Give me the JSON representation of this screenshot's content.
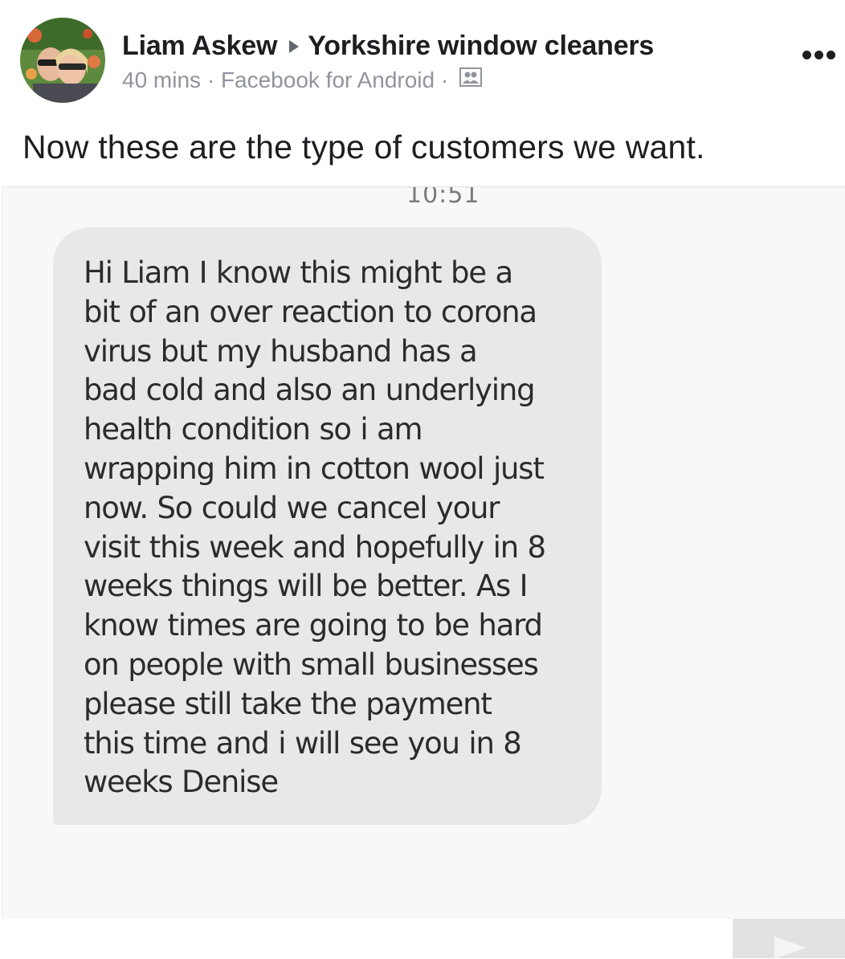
{
  "post": {
    "author": "Liam Askew",
    "group": "Yorkshire window cleaners",
    "time": "40 mins",
    "separator": "·",
    "source": "Facebook for Android",
    "audience_icon": "group-icon",
    "more_icon": "more-options-icon",
    "text": "Now these are the type of customers we want."
  },
  "screenshot": {
    "time": "10:51",
    "message_lines": [
      "Hi Liam I know this might be a",
      "bit of an over reaction to corona",
      "virus but my husband has a",
      "bad cold and also an underlying",
      "health condition so i am",
      "wrapping him in cotton wool just",
      "now. So could we cancel your",
      "visit this week and hopefully in 8",
      "weeks things will be better. As I",
      "know times are going to be hard",
      "on people with small businesses",
      "please still take the payment",
      "this time and i will see you in 8",
      "weeks Denise"
    ]
  },
  "colors": {
    "text": "#1c1e21",
    "meta": "#90949c",
    "bubble": "#e8e8e8",
    "screenshot_bg": "#f8f8f8"
  }
}
